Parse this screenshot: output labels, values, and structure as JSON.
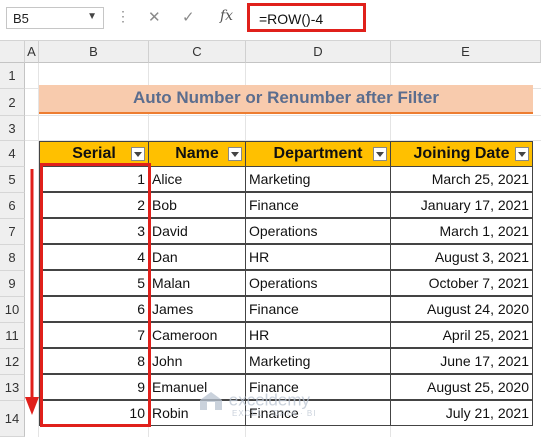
{
  "namebox": {
    "value": "B5",
    "dropdown_icon": "chevron-down-icon"
  },
  "formula_bar": {
    "separator_icon": "vertical-dots-icon",
    "cancel_icon": "close-icon",
    "enter_icon": "check-icon",
    "fx_label": "fx",
    "formula": "=ROW()-4"
  },
  "columns": [
    "A",
    "B",
    "C",
    "D",
    "E"
  ],
  "rows": [
    "1",
    "2",
    "3",
    "4",
    "5",
    "6",
    "7",
    "8",
    "9",
    "10",
    "11",
    "12",
    "13",
    "14"
  ],
  "title": "Auto Number or Renumber after Filter",
  "table": {
    "headers": [
      "Serial",
      "Name",
      "Department",
      "Joining Date"
    ],
    "filter_icon": "filter-dropdown-icon",
    "rows": [
      {
        "serial": "1",
        "name": "Alice",
        "department": "Marketing",
        "date": "March 25, 2021"
      },
      {
        "serial": "2",
        "name": "Bob",
        "department": "Finance",
        "date": "January 17, 2021"
      },
      {
        "serial": "3",
        "name": "David",
        "department": "Operations",
        "date": "March 1, 2021"
      },
      {
        "serial": "4",
        "name": "Dan",
        "department": "HR",
        "date": "August 3, 2021"
      },
      {
        "serial": "5",
        "name": "Malan",
        "department": "Operations",
        "date": "October 7, 2021"
      },
      {
        "serial": "6",
        "name": "James",
        "department": "Finance",
        "date": "August 24, 2020"
      },
      {
        "serial": "7",
        "name": "Cameroon",
        "department": "HR",
        "date": "April 25, 2021"
      },
      {
        "serial": "8",
        "name": "John",
        "department": "Marketing",
        "date": "June 17, 2021"
      },
      {
        "serial": "9",
        "name": "Emanuel",
        "department": "Finance",
        "date": "August 25, 2020"
      },
      {
        "serial": "10",
        "name": "Robin",
        "department": "Finance",
        "date": "July 21, 2021"
      }
    ]
  },
  "watermark": {
    "name": "exceldemy",
    "tagline": "EXCEL · DATA · BI"
  },
  "colors": {
    "header_fill": "#ffc000",
    "title_fill": "#f8cbad",
    "highlight": "#e0201b"
  }
}
